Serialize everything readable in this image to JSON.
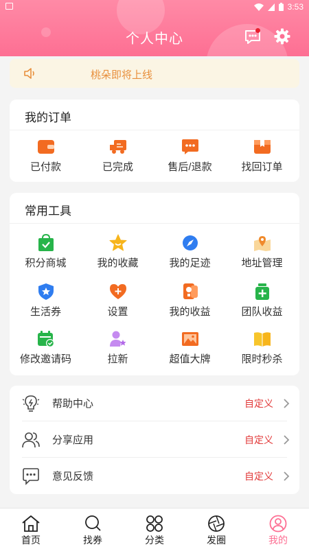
{
  "status_bar": {
    "time": "3:53"
  },
  "header": {
    "title": "个人中心"
  },
  "notice": {
    "text": "桃朵即将上线"
  },
  "orders": {
    "title": "我的订单",
    "items": [
      {
        "label": "已付款",
        "icon": "wallet-icon",
        "color": "#f26b21"
      },
      {
        "label": "已完成",
        "icon": "truck-icon",
        "color": "#f26b21"
      },
      {
        "label": "售后/退款",
        "icon": "chat-dots-icon",
        "color": "#f26b21"
      },
      {
        "label": "找回订单",
        "icon": "box-icon",
        "color": "#f26b21"
      }
    ]
  },
  "tools": {
    "title": "常用工具",
    "items": [
      {
        "label": "积分商城",
        "icon": "shopping-bag-icon",
        "color": "#27b44a"
      },
      {
        "label": "我的收藏",
        "icon": "star-icon",
        "color": "#f7b51c"
      },
      {
        "label": "我的足迹",
        "icon": "compass-icon",
        "color": "#2f7df0"
      },
      {
        "label": "地址管理",
        "icon": "map-pin-icon",
        "color": "#f5c064"
      },
      {
        "label": "生活券",
        "icon": "shield-star-icon",
        "color": "#2f7df0"
      },
      {
        "label": "设置",
        "icon": "heart-plus-icon",
        "color": "#f26b21"
      },
      {
        "label": "我的收益",
        "icon": "coin-card-icon",
        "color": "#f26b21"
      },
      {
        "label": "团队收益",
        "icon": "jar-plus-icon",
        "color": "#27b44a"
      },
      {
        "label": "修改邀请码",
        "icon": "calendar-check-icon",
        "color": "#27b44a"
      },
      {
        "label": "拉新",
        "icon": "user-star-icon",
        "color": "#c58af0"
      },
      {
        "label": "超值大牌",
        "icon": "picture-icon",
        "color": "#f26b21"
      },
      {
        "label": "限时秒杀",
        "icon": "book-icon",
        "color": "#f7c52b"
      }
    ]
  },
  "menu": [
    {
      "label": "帮助中心",
      "value": "自定义",
      "icon": "bulb-icon"
    },
    {
      "label": "分享应用",
      "value": "自定义",
      "icon": "people-icon"
    },
    {
      "label": "意见反馈",
      "value": "自定义",
      "icon": "feedback-icon"
    }
  ],
  "tabbar": {
    "active_index": 4,
    "items": [
      {
        "label": "首页",
        "icon": "home-icon"
      },
      {
        "label": "找券",
        "icon": "search-icon"
      },
      {
        "label": "分类",
        "icon": "category-icon"
      },
      {
        "label": "发圈",
        "icon": "aperture-icon"
      },
      {
        "label": "我的",
        "icon": "user-icon"
      }
    ]
  },
  "accent_color": "#fd6f93",
  "value_color": "#e23a3a"
}
